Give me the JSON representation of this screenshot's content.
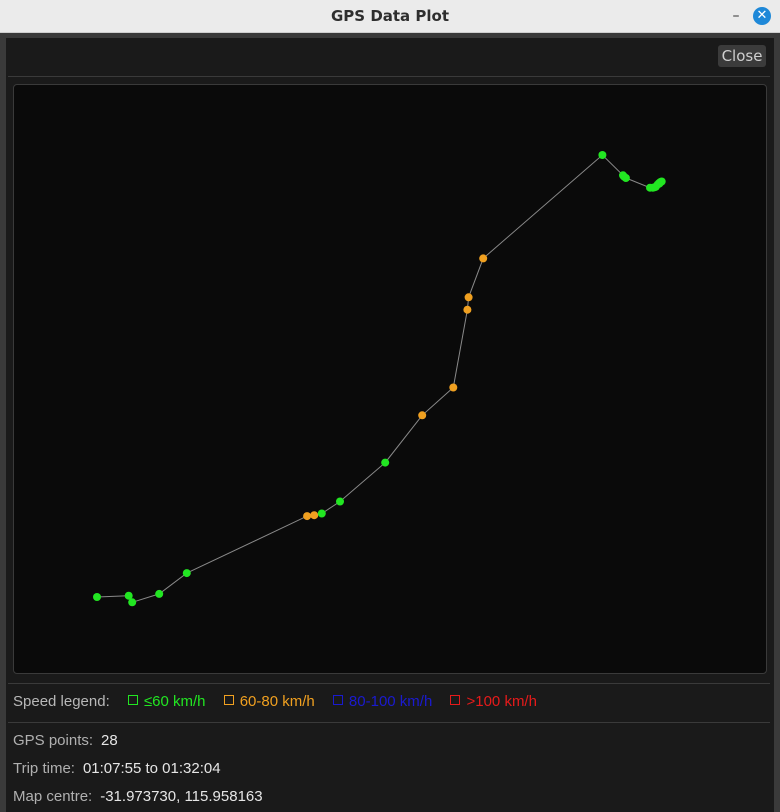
{
  "window": {
    "title": "GPS Data Plot",
    "minimize_glyph": "–",
    "close_glyph": "✕"
  },
  "toolbar": {
    "close_label": "Close"
  },
  "legend": {
    "label": "Speed legend:",
    "items": [
      {
        "label": "≤60 km/h",
        "color": "#22e622"
      },
      {
        "label": "60-80 km/h",
        "color": "#f0a020"
      },
      {
        "label": "80-100 km/h",
        "color": "#1a1ad0"
      },
      {
        "label": ">100 km/h",
        "color": "#e61a1a"
      }
    ]
  },
  "info": {
    "points_label": "GPS points:",
    "points_value": "28",
    "time_label": "Trip time:",
    "time_value": "01:07:55 to 01:32:04",
    "centre_label": "Map centre:",
    "centre_value": "-31.973730, 115.958163"
  },
  "chart_data": {
    "type": "scatter",
    "route_line_color": "#8a8a8a",
    "speed_colors": {
      "low": "#22e622",
      "mid": "#f0a020"
    },
    "points": [
      {
        "x": 0.0,
        "y": 0.0,
        "speed_band": "low"
      },
      {
        "x": 0.054,
        "y": 0.003,
        "speed_band": "low"
      },
      {
        "x": 0.06,
        "y": -0.012,
        "speed_band": "low"
      },
      {
        "x": 0.106,
        "y": 0.007,
        "speed_band": "low"
      },
      {
        "x": 0.153,
        "y": 0.054,
        "speed_band": "low"
      },
      {
        "x": 0.358,
        "y": 0.183,
        "speed_band": "mid"
      },
      {
        "x": 0.37,
        "y": 0.185,
        "speed_band": "mid"
      },
      {
        "x": 0.383,
        "y": 0.189,
        "speed_band": "low"
      },
      {
        "x": 0.414,
        "y": 0.216,
        "speed_band": "low"
      },
      {
        "x": 0.491,
        "y": 0.304,
        "speed_band": "low"
      },
      {
        "x": 0.554,
        "y": 0.411,
        "speed_band": "mid"
      },
      {
        "x": 0.607,
        "y": 0.474,
        "speed_band": "mid"
      },
      {
        "x": 0.631,
        "y": 0.65,
        "speed_band": "mid"
      },
      {
        "x": 0.633,
        "y": 0.678,
        "speed_band": "mid"
      },
      {
        "x": 0.658,
        "y": 0.766,
        "speed_band": "mid"
      },
      {
        "x": 0.861,
        "y": 1.0,
        "speed_band": "low"
      },
      {
        "x": 0.896,
        "y": 0.954,
        "speed_band": "low"
      },
      {
        "x": 0.898,
        "y": 0.951,
        "speed_band": "low"
      },
      {
        "x": 0.901,
        "y": 0.948,
        "speed_band": "low"
      },
      {
        "x": 0.942,
        "y": 0.926,
        "speed_band": "low"
      },
      {
        "x": 0.947,
        "y": 0.926,
        "speed_band": "low"
      },
      {
        "x": 0.95,
        "y": 0.927,
        "speed_band": "low"
      },
      {
        "x": 0.952,
        "y": 0.928,
        "speed_band": "low"
      },
      {
        "x": 0.955,
        "y": 0.933,
        "speed_band": "low"
      },
      {
        "x": 0.957,
        "y": 0.936,
        "speed_band": "low"
      },
      {
        "x": 0.96,
        "y": 0.939,
        "speed_band": "low"
      },
      {
        "x": 0.962,
        "y": 0.94,
        "speed_band": "low"
      },
      {
        "x": 0.958,
        "y": 0.935,
        "speed_band": "low"
      }
    ]
  }
}
